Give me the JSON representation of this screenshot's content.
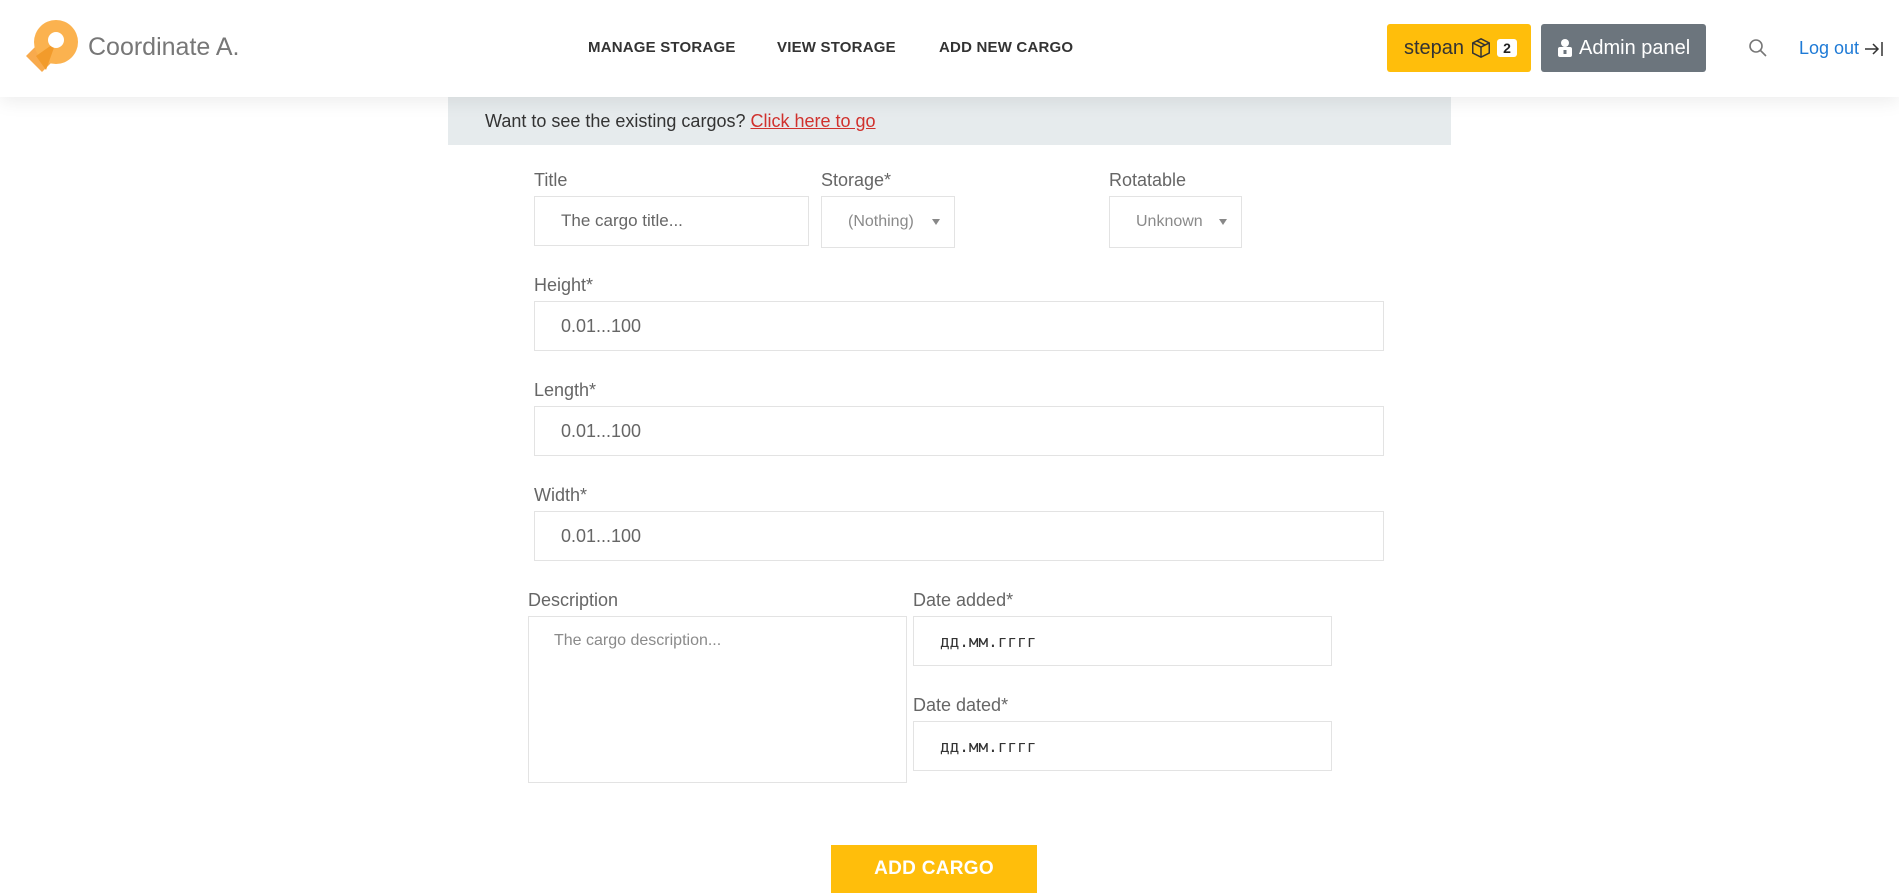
{
  "header": {
    "brand": "Coordinate A.",
    "nav": [
      "MANAGE STORAGE",
      "VIEW STORAGE",
      "ADD NEW CARGO"
    ],
    "user_name": "stepan",
    "cart_count": "2",
    "admin_label": "Admin panel",
    "logout_label": "Log out"
  },
  "info": {
    "text": "Want to see the existing cargos? ",
    "link": "Click here to go"
  },
  "form": {
    "title_label": "Title",
    "title_placeholder": "The cargo title...",
    "storage_label": "Storage*",
    "storage_value": "(Nothing)",
    "rotatable_label": "Rotatable",
    "rotatable_value": "Unknown",
    "height_label": "Height*",
    "height_placeholder": "0.01...100",
    "length_label": "Length*",
    "length_placeholder": "0.01...100",
    "width_label": "Width*",
    "width_placeholder": "0.01...100",
    "description_label": "Description",
    "description_placeholder": "The cargo description...",
    "date_added_label": "Date added*",
    "date_added_placeholder": "дд.мм.гггг",
    "date_dated_label": "Date dated*",
    "date_dated_placeholder": "дд.мм.гггг",
    "submit_label": "ADD CARGO"
  },
  "colors": {
    "accent": "#ffbe0b",
    "admin": "#6c757d",
    "link": "#d0312d",
    "logout": "#1e7ad6"
  }
}
